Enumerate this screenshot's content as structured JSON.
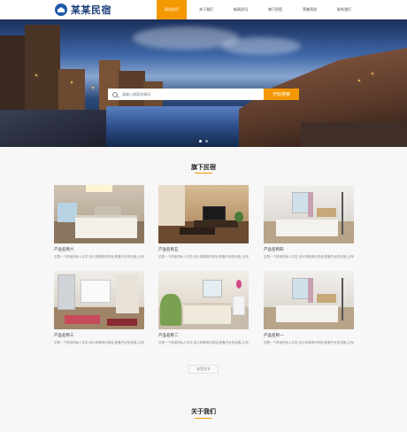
{
  "header": {
    "logo_text": "某某民宿",
    "nav": [
      "网站首页",
      "关于我们",
      "新闻资讯",
      "旗下民宿",
      "荣誉资质",
      "联系我们"
    ],
    "active_index": 0
  },
  "banner": {
    "search_placeholder": "请输入搜索关键词",
    "search_button": "开始搜索",
    "slide_count": 2,
    "active_slide": 0
  },
  "products": {
    "title": "旗下民宿",
    "items": [
      {
        "name": "产品名称六",
        "desc": "这是一个舒适的私人住宅,设计风格简约舒适,配备齐全的设施,让你感受到家的温馨和舒适体验。"
      },
      {
        "name": "产品名称五",
        "desc": "这是一个舒适的私人住宅,设计风格简约舒适,配备齐全的设施,让你感受到家的温馨和舒适体验。"
      },
      {
        "name": "产品名称四",
        "desc": "这是一个舒适的私人住宅,设计风格简约舒适,配备齐全的设施,让你感受到家的温馨和舒适体验。"
      },
      {
        "name": "产品名称三",
        "desc": "这是一个舒适的私人住宅,设计风格简约舒适,配备齐全的设施,让你感受到家的温馨和舒适体验。"
      },
      {
        "name": "产品名称二",
        "desc": "这是一个舒适的私人住宅,设计风格简约舒适,配备齐全的设施,让你感受到家的温馨和舒适体验。"
      },
      {
        "name": "产品名称一",
        "desc": "这是一个舒适的私人住宅,设计风格简约舒适,配备齐全的设施,让你感受到家的温馨和舒适体验。"
      }
    ],
    "more_label": "查看更多"
  },
  "about": {
    "title": "关于我们"
  },
  "colors": {
    "accent": "#f39800",
    "logo_blue": "#1a3e78"
  }
}
